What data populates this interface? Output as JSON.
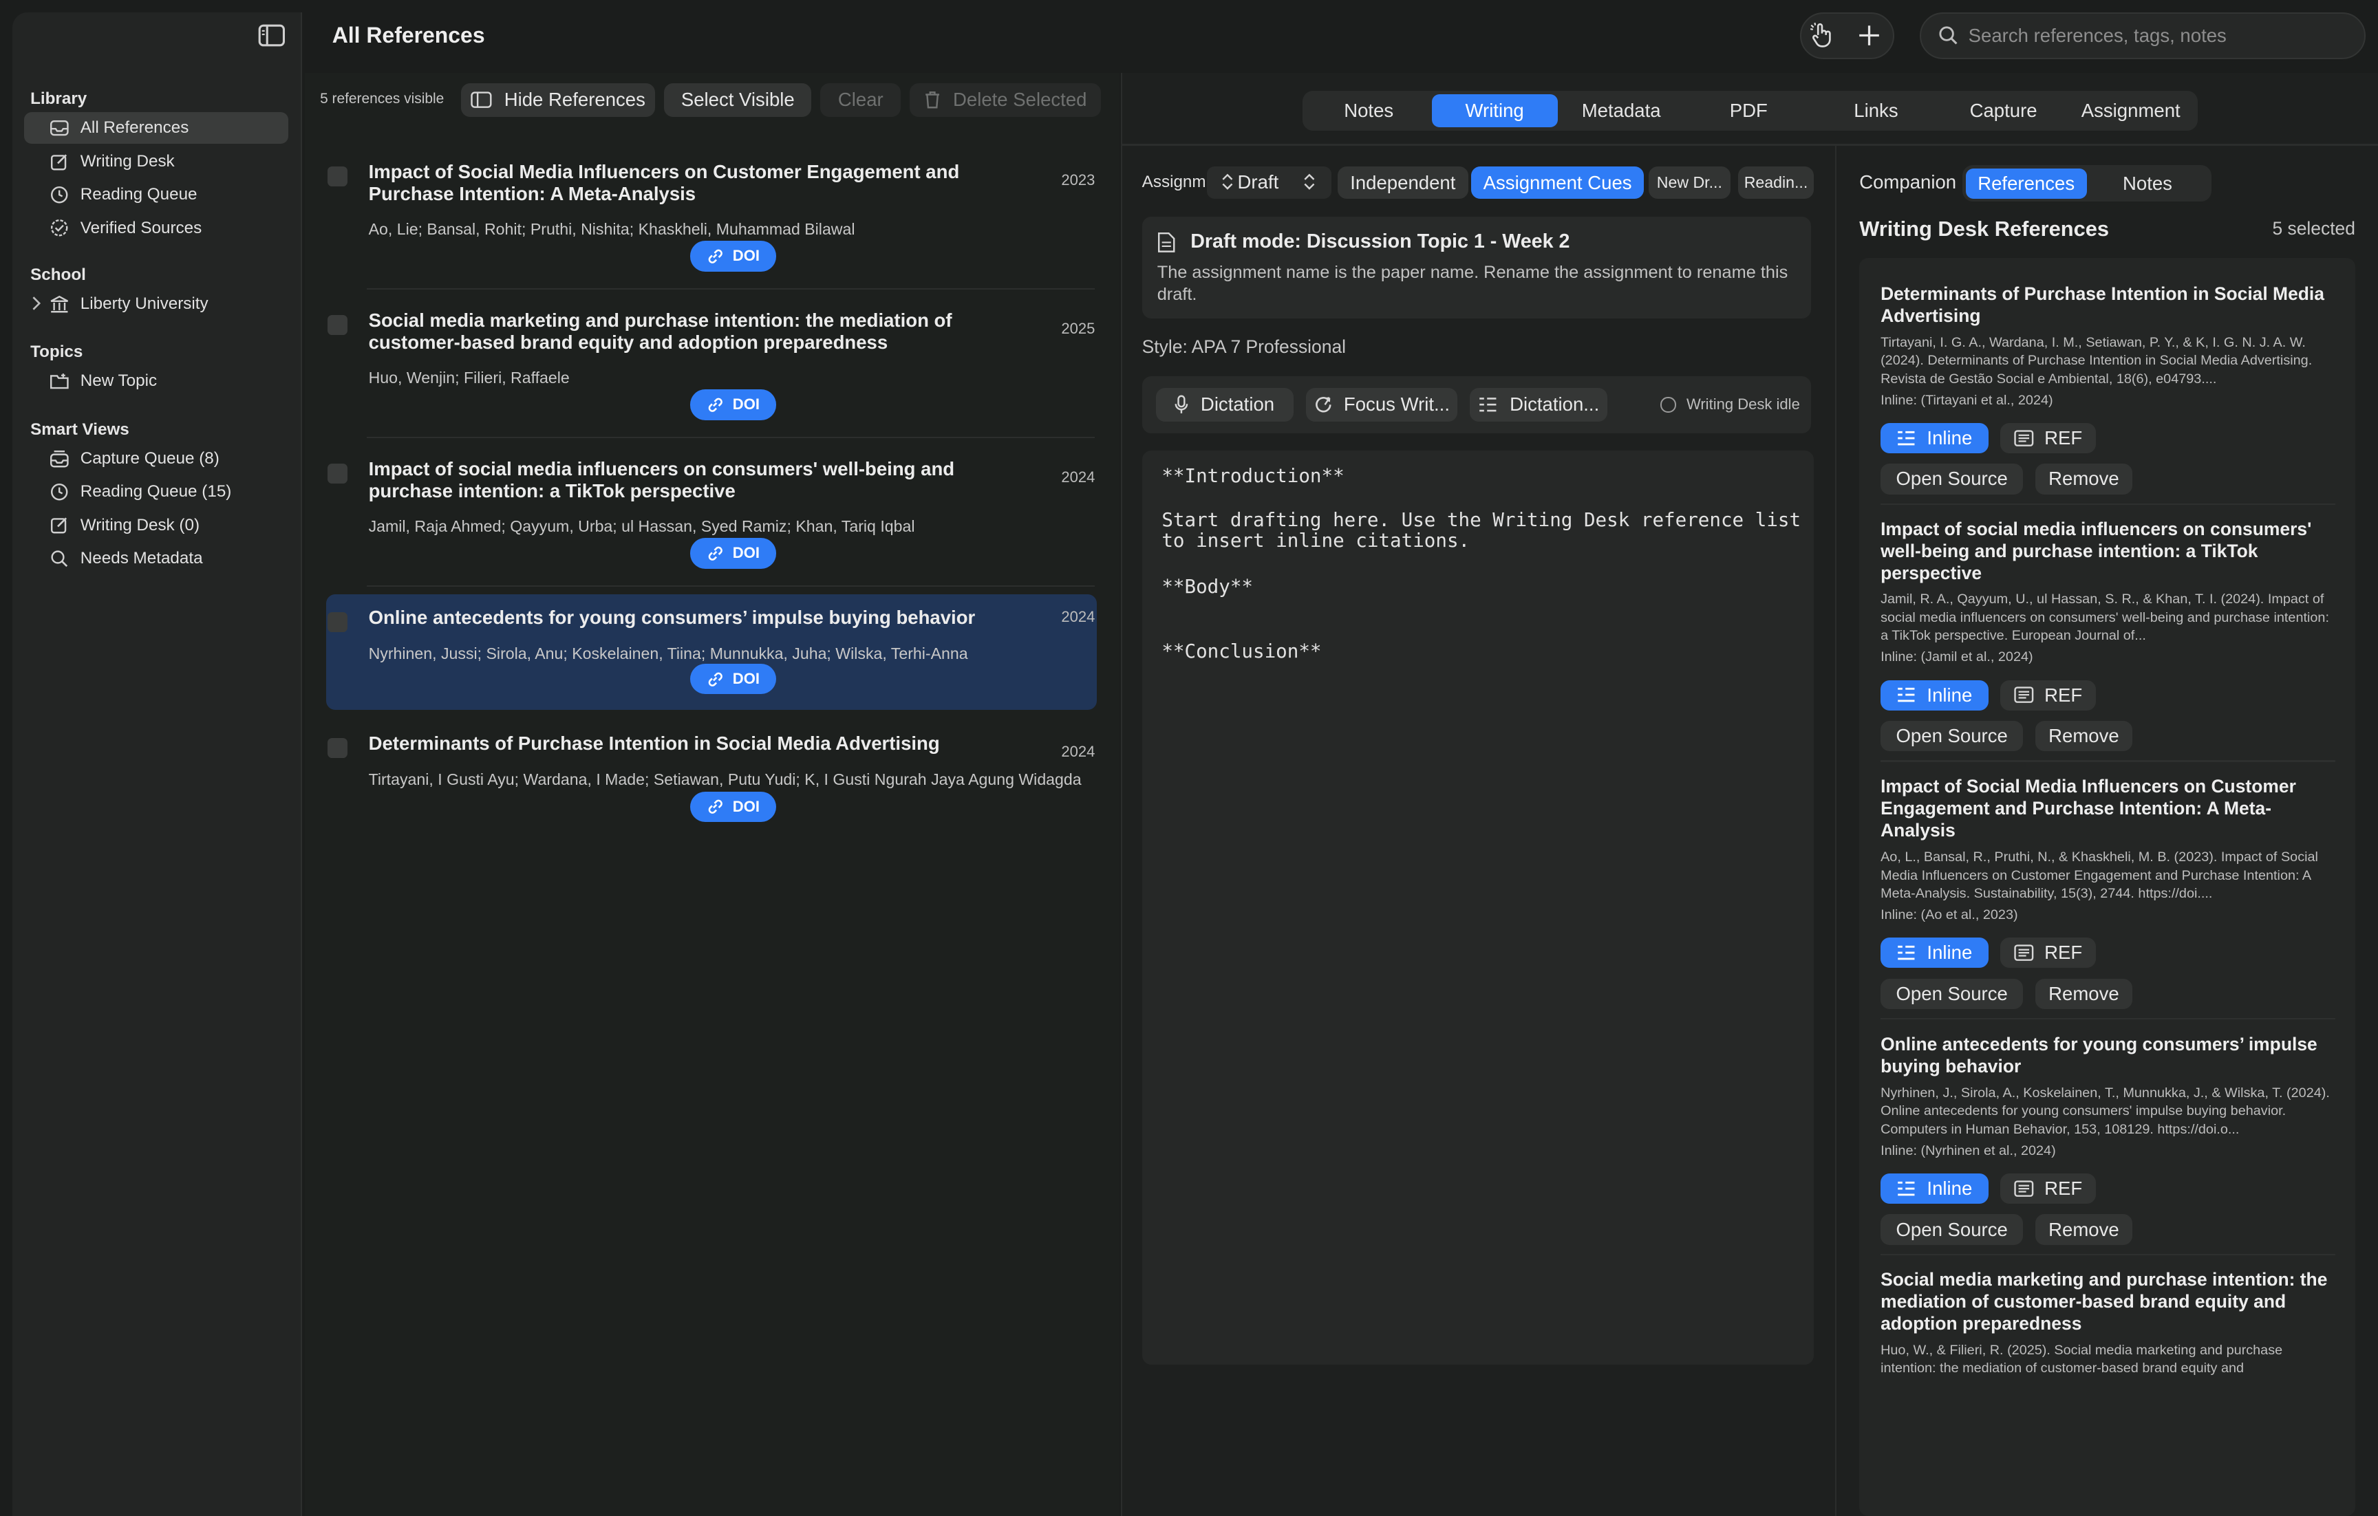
{
  "header": {
    "title": "All References",
    "search_placeholder": "Search references, tags, notes"
  },
  "sidebar": {
    "library_label": "Library",
    "library_items": [
      "All References",
      "Writing Desk",
      "Reading Queue",
      "Verified Sources"
    ],
    "school_label": "School",
    "school_items": [
      "Liberty University"
    ],
    "topics_label": "Topics",
    "topics_items": [
      "New Topic"
    ],
    "smart_label": "Smart Views",
    "smart_items": [
      "Capture Queue (8)",
      "Reading Queue (15)",
      "Writing Desk (0)",
      "Needs Metadata"
    ]
  },
  "list": {
    "count_text": "5 references visible",
    "hide_label": "Hide References",
    "select_visible_label": "Select Visible",
    "clear_label": "Clear",
    "delete_label": "Delete Selected",
    "doi_label": "DOI",
    "items": [
      {
        "title": "Impact of Social Media Influencers on Customer Engagement and Purchase Intention: A Meta-Analysis",
        "year": "2023",
        "authors": "Ao, Lie; Bansal, Rohit; Pruthi, Nishita; Khaskheli, Muhammad Bilawal"
      },
      {
        "title": "Social media marketing and purchase intention: the mediation of customer-based brand equity and adoption preparedness",
        "year": "2025",
        "authors": "Huo, Wenjin; Filieri, Raffaele"
      },
      {
        "title": "Impact of social media influencers on consumers' well-being and purchase intention: a TikTok perspective",
        "year": "2024",
        "authors": "Jamil, Raja Ahmed; Qayyum, Urba; ul Hassan, Syed Ramiz; Khan, Tariq Iqbal"
      },
      {
        "title": "Online antecedents for young consumers’ impulse buying behavior",
        "year": "2024",
        "authors": "Nyrhinen, Jussi; Sirola, Anu; Koskelainen, Tiina; Munnukka, Juha; Wilska, Terhi-Anna"
      },
      {
        "title": "Determinants of Purchase Intention in Social Media Advertising",
        "year": "2024",
        "authors": "Tirtayani, I Gusti Ayu; Wardana, I Made; Setiawan, Putu Yudi; K, I Gusti Ngurah Jaya Agung Widagda"
      }
    ]
  },
  "detail": {
    "tabs": [
      "Notes",
      "Writing",
      "Metadata",
      "PDF",
      "Links",
      "Capture",
      "Assignment"
    ],
    "active_tab": "Writing",
    "assign_label": "Assignm...",
    "draft_label": "Draft",
    "mode_independent": "Independent",
    "mode_cues": "Assignment Cues",
    "new_draft": "New Dr...",
    "reading": "Readin...",
    "draft_title": "Draft mode: Discussion Topic 1 - Week 2",
    "draft_desc": "The assignment name is the paper name. Rename the assignment to rename this draft.",
    "style": "Style: APA 7 Professional",
    "dictation": "Dictation",
    "focus": "Focus Writ...",
    "dictation2": "Dictation...",
    "status": "Writing Desk idle",
    "editor_intro": "**Introduction**",
    "editor_line1": "Start drafting here. Use the Writing Desk reference list",
    "editor_line2": "to insert inline citations.",
    "editor_body": "**Body**",
    "editor_concl": "**Conclusion**"
  },
  "companion": {
    "label": "Companion",
    "tab_refs": "References",
    "tab_notes": "Notes",
    "heading": "Writing Desk References",
    "selected": "5 selected",
    "inline_label": "Inline",
    "ref_label": "REF",
    "open_label": "Open Source",
    "remove_label": "Remove",
    "items": [
      {
        "title": "Determinants of Purchase Intention in Social Media Advertising",
        "citation": "Tirtayani, I. G. A., Wardana, I. M., Setiawan, P. Y., & K, I. G. N. J. A. W. (2024). Determinants of Purchase Intention in Social Media Advertising. Revista de Gestão Social e Ambiental, 18(6), e04793....",
        "inline": "Inline: (Tirtayani et al., 2024)"
      },
      {
        "title": "Impact of social media influencers on consumers' well-being and purchase intention: a TikTok perspective",
        "citation": "Jamil, R. A., Qayyum, U., ul Hassan, S. R., & Khan, T. I. (2024). Impact of social media influencers on consumers' well-being and purchase intention: a TikTok perspective. European Journal of...",
        "inline": "Inline: (Jamil et al., 2024)"
      },
      {
        "title": "Impact of Social Media Influencers on Customer Engagement and Purchase Intention: A Meta-Analysis",
        "citation": "Ao, L., Bansal, R., Pruthi, N., & Khaskheli, M. B. (2023). Impact of Social Media Influencers on Customer Engagement and Purchase Intention: A Meta-Analysis. Sustainability, 15(3), 2744. https://doi....",
        "inline": "Inline: (Ao et al., 2023)"
      },
      {
        "title": "Online antecedents for young consumers’ impulse buying behavior",
        "citation": "Nyrhinen, J., Sirola, A., Koskelainen, T., Munnukka, J., & Wilska, T. (2024). Online antecedents for young consumers' impulse buying behavior. Computers in Human Behavior, 153, 108129. https://doi.o...",
        "inline": "Inline: (Nyrhinen et al., 2024)"
      },
      {
        "title": "Social media marketing and purchase intention: the mediation of customer-based brand equity and adoption preparedness",
        "citation": "Huo, W., & Filieri, R. (2025). Social media marketing and purchase intention: the mediation of customer-based brand equity and",
        "inline": ""
      }
    ]
  }
}
